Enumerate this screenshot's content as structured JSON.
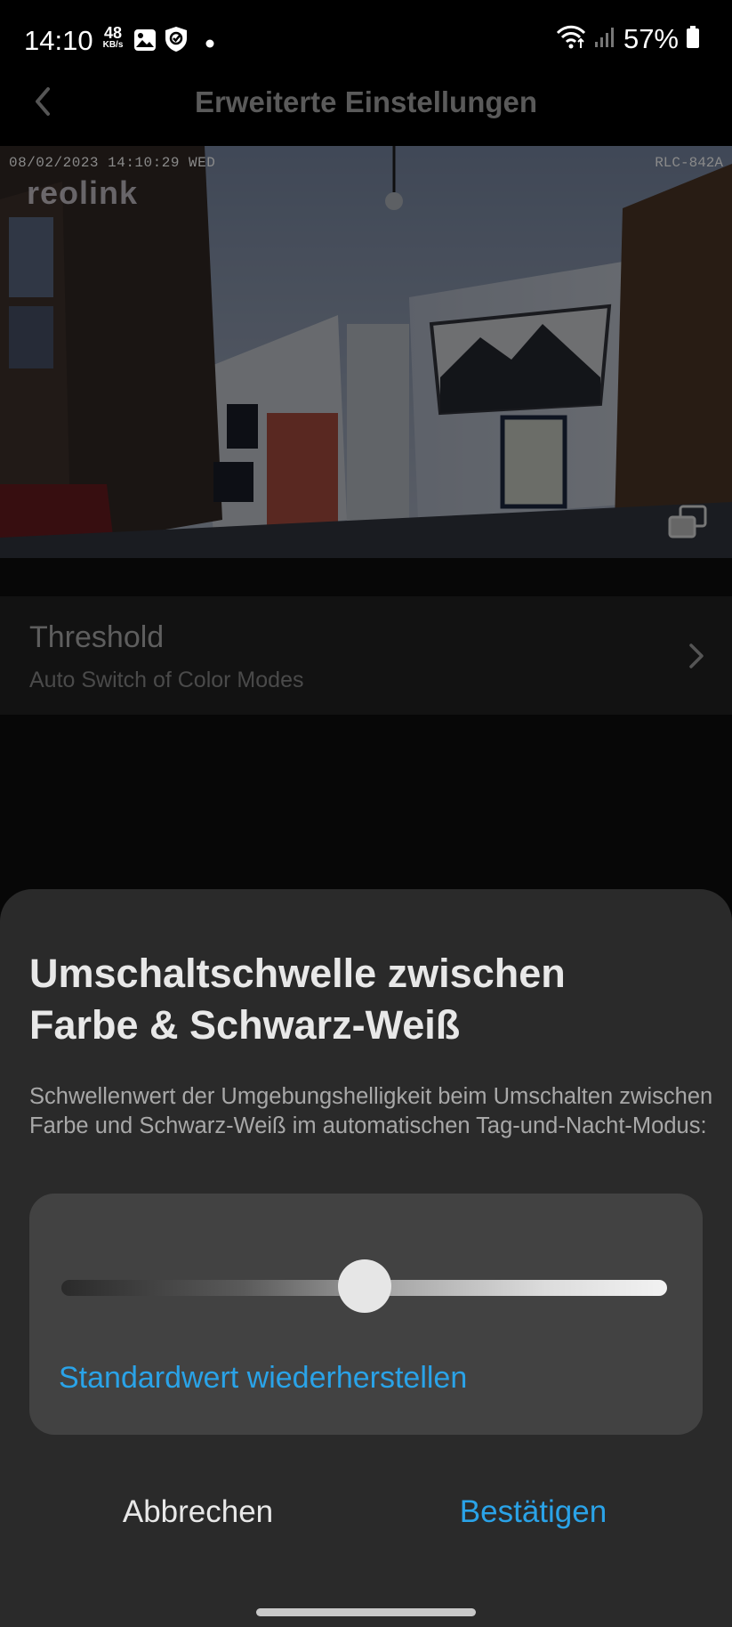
{
  "status_bar": {
    "time": "14:10",
    "speed_value": "48",
    "speed_unit": "KB/s",
    "battery": "57%"
  },
  "header": {
    "title": "Erweiterte Einstellungen"
  },
  "camera": {
    "timestamp": "08/02/2023 14:10:29 WED",
    "model": "RLC-842A",
    "logo": "reolink"
  },
  "settings": {
    "threshold_title": "Threshold",
    "threshold_subtitle": "Auto Switch of Color Modes"
  },
  "sheet": {
    "title_line1": "Umschaltschwelle zwischen",
    "title_line2": "Farbe & Schwarz-Weiß",
    "description": "Schwellenwert der Umgebungshelligkeit beim Umschalten zwischen Farbe und Schwarz-Weiß im automatischen Tag-und-Nacht-Modus:",
    "slider_value_fraction": 0.5,
    "reset_label": "Standardwert wiederherstellen",
    "cancel_label": "Abbrechen",
    "confirm_label": "Bestätigen"
  },
  "colors": {
    "accent": "#2aa3e8",
    "sheet_bg": "#2a2a2a",
    "card_bg": "#424242"
  }
}
